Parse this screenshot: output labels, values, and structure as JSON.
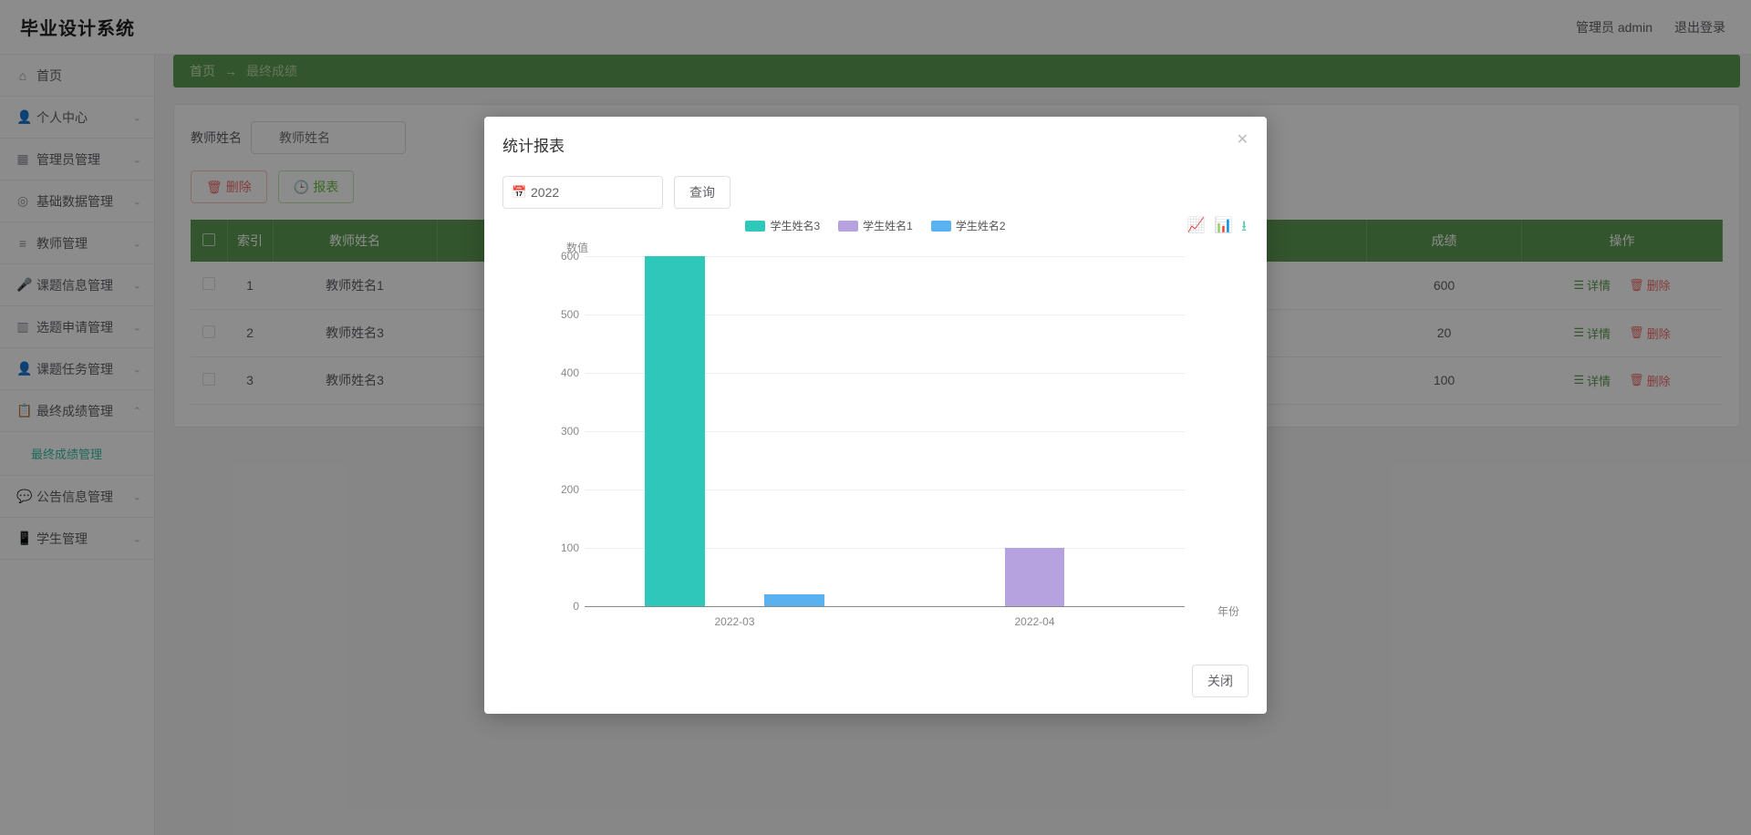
{
  "header": {
    "brand": "毕业设计系统",
    "user_label": "管理员 admin",
    "logout": "退出登录"
  },
  "sidebar": {
    "items": [
      {
        "icon": "⌂",
        "label": "首页",
        "has_sub": false
      },
      {
        "icon": "👤",
        "label": "个人中心",
        "has_sub": true
      },
      {
        "icon": "▦",
        "label": "管理员管理",
        "has_sub": true
      },
      {
        "icon": "◎",
        "label": "基础数据管理",
        "has_sub": true
      },
      {
        "icon": "≡",
        "label": "教师管理",
        "has_sub": true
      },
      {
        "icon": "🎤",
        "label": "课题信息管理",
        "has_sub": true
      },
      {
        "icon": "▥",
        "label": "选题申请管理",
        "has_sub": true
      },
      {
        "icon": "👤",
        "label": "课题任务管理",
        "has_sub": true
      },
      {
        "icon": "📋",
        "label": "最终成绩管理",
        "has_sub": true,
        "expanded": true
      },
      {
        "icon": "💬",
        "label": "公告信息管理",
        "has_sub": true
      },
      {
        "icon": "📱",
        "label": "学生管理",
        "has_sub": true
      }
    ],
    "sub_active": "最终成绩管理"
  },
  "breadcrumb": {
    "home": "首页",
    "arrow": "→",
    "current": "最终成绩"
  },
  "search": {
    "label": "教师姓名",
    "placeholder": "教师姓名"
  },
  "toolbar": {
    "delete": "删除",
    "report": "报表"
  },
  "table": {
    "headers": {
      "checkbox": "",
      "index": "索引",
      "teacher": "教师姓名",
      "score": "成绩",
      "ops": "操作"
    },
    "ops": {
      "detail": "详情",
      "delete": "删除"
    },
    "rows": [
      {
        "index": "1",
        "teacher": "教师姓名1",
        "score": "600"
      },
      {
        "index": "2",
        "teacher": "教师姓名3",
        "score": "20"
      },
      {
        "index": "3",
        "teacher": "教师姓名3",
        "score": "100"
      }
    ]
  },
  "dialog": {
    "title": "统计报表",
    "year_value": "2022",
    "query": "查询",
    "close": "关闭"
  },
  "chart_data": {
    "type": "bar",
    "title": "",
    "xlabel": "年份",
    "ylabel": "数值",
    "ylim": [
      0,
      600
    ],
    "yticks": [
      0,
      100,
      200,
      300,
      400,
      500,
      600
    ],
    "categories": [
      "2022-03",
      "2022-04"
    ],
    "series": [
      {
        "name": "学生姓名3",
        "color": "#2ec7ba",
        "values": [
          600,
          0
        ]
      },
      {
        "name": "学生姓名1",
        "color": "#b6a2de",
        "values": [
          0,
          100
        ]
      },
      {
        "name": "学生姓名2",
        "color": "#5ab1ef",
        "values": [
          20,
          0
        ]
      }
    ]
  }
}
